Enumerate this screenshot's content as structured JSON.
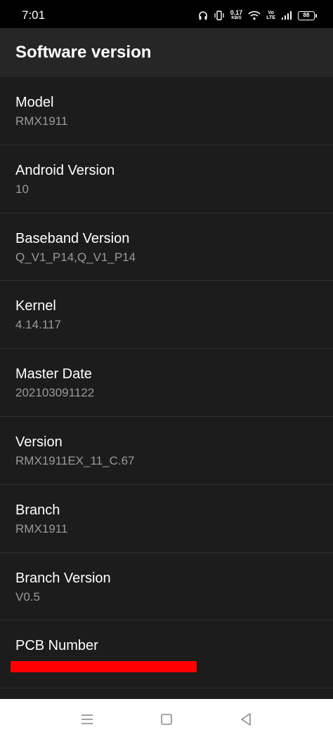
{
  "status_bar": {
    "time": "7:01",
    "net_speed_value": "0.17",
    "net_speed_unit": "KB/S",
    "volte_top": "Vo",
    "volte_bottom": "LTE",
    "battery_level": "88"
  },
  "header": {
    "title": "Software version"
  },
  "items": [
    {
      "title": "Model",
      "value": "RMX1911"
    },
    {
      "title": "Android Version",
      "value": "10"
    },
    {
      "title": "Baseband Version",
      "value": "Q_V1_P14,Q_V1_P14"
    },
    {
      "title": "Kernel",
      "value": "4.14.117"
    },
    {
      "title": "Master Date",
      "value": "202103091122"
    },
    {
      "title": "Version",
      "value": "RMX1911EX_11_C.67"
    },
    {
      "title": "Branch",
      "value": "RMX1911"
    },
    {
      "title": "Branch Version",
      "value": "V0.5"
    },
    {
      "title": "PCB Number",
      "value": ""
    }
  ],
  "colors": {
    "background": "#1c1c1c",
    "header_background": "#262626",
    "status_bar_background": "#000000",
    "title_text": "#ffffff",
    "value_text": "#9a9a9a",
    "redaction": "#ff0000",
    "nav_bar_background": "#ffffff",
    "nav_icon": "#8a8a8a"
  },
  "nav_bar": {
    "icons": [
      "menu-icon",
      "home-icon",
      "back-icon"
    ]
  }
}
